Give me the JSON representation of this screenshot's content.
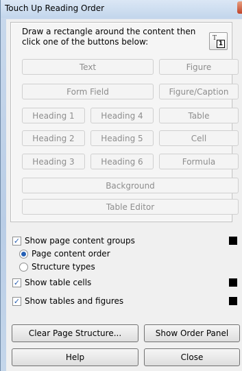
{
  "window": {
    "title": "Touch Up Reading Order"
  },
  "instructions": "Draw a rectangle around the content then click one of the buttons below:",
  "buttons": {
    "text": "Text",
    "figure": "Figure",
    "form_field": "Form Field",
    "figure_caption": "Figure/Caption",
    "heading1": "Heading 1",
    "heading4": "Heading 4",
    "table": "Table",
    "heading2": "Heading 2",
    "heading5": "Heading 5",
    "cell": "Cell",
    "heading3": "Heading 3",
    "heading6": "Heading 6",
    "formula": "Formula",
    "background": "Background",
    "table_editor": "Table Editor"
  },
  "options": {
    "show_page_content_groups": {
      "label": "Show page content groups",
      "checked": true,
      "color": "#000000"
    },
    "page_content_order": {
      "label": "Page content order",
      "selected": true
    },
    "structure_types": {
      "label": "Structure types",
      "selected": false
    },
    "show_table_cells": {
      "label": "Show table cells",
      "checked": true,
      "color": "#000000"
    },
    "show_tables_and_figures": {
      "label": "Show tables and figures",
      "checked": true,
      "color": "#000000"
    }
  },
  "actions": {
    "clear_page_structure": "Clear Page Structure...",
    "show_order_panel": "Show Order Panel",
    "help": "Help",
    "close": "Close"
  }
}
